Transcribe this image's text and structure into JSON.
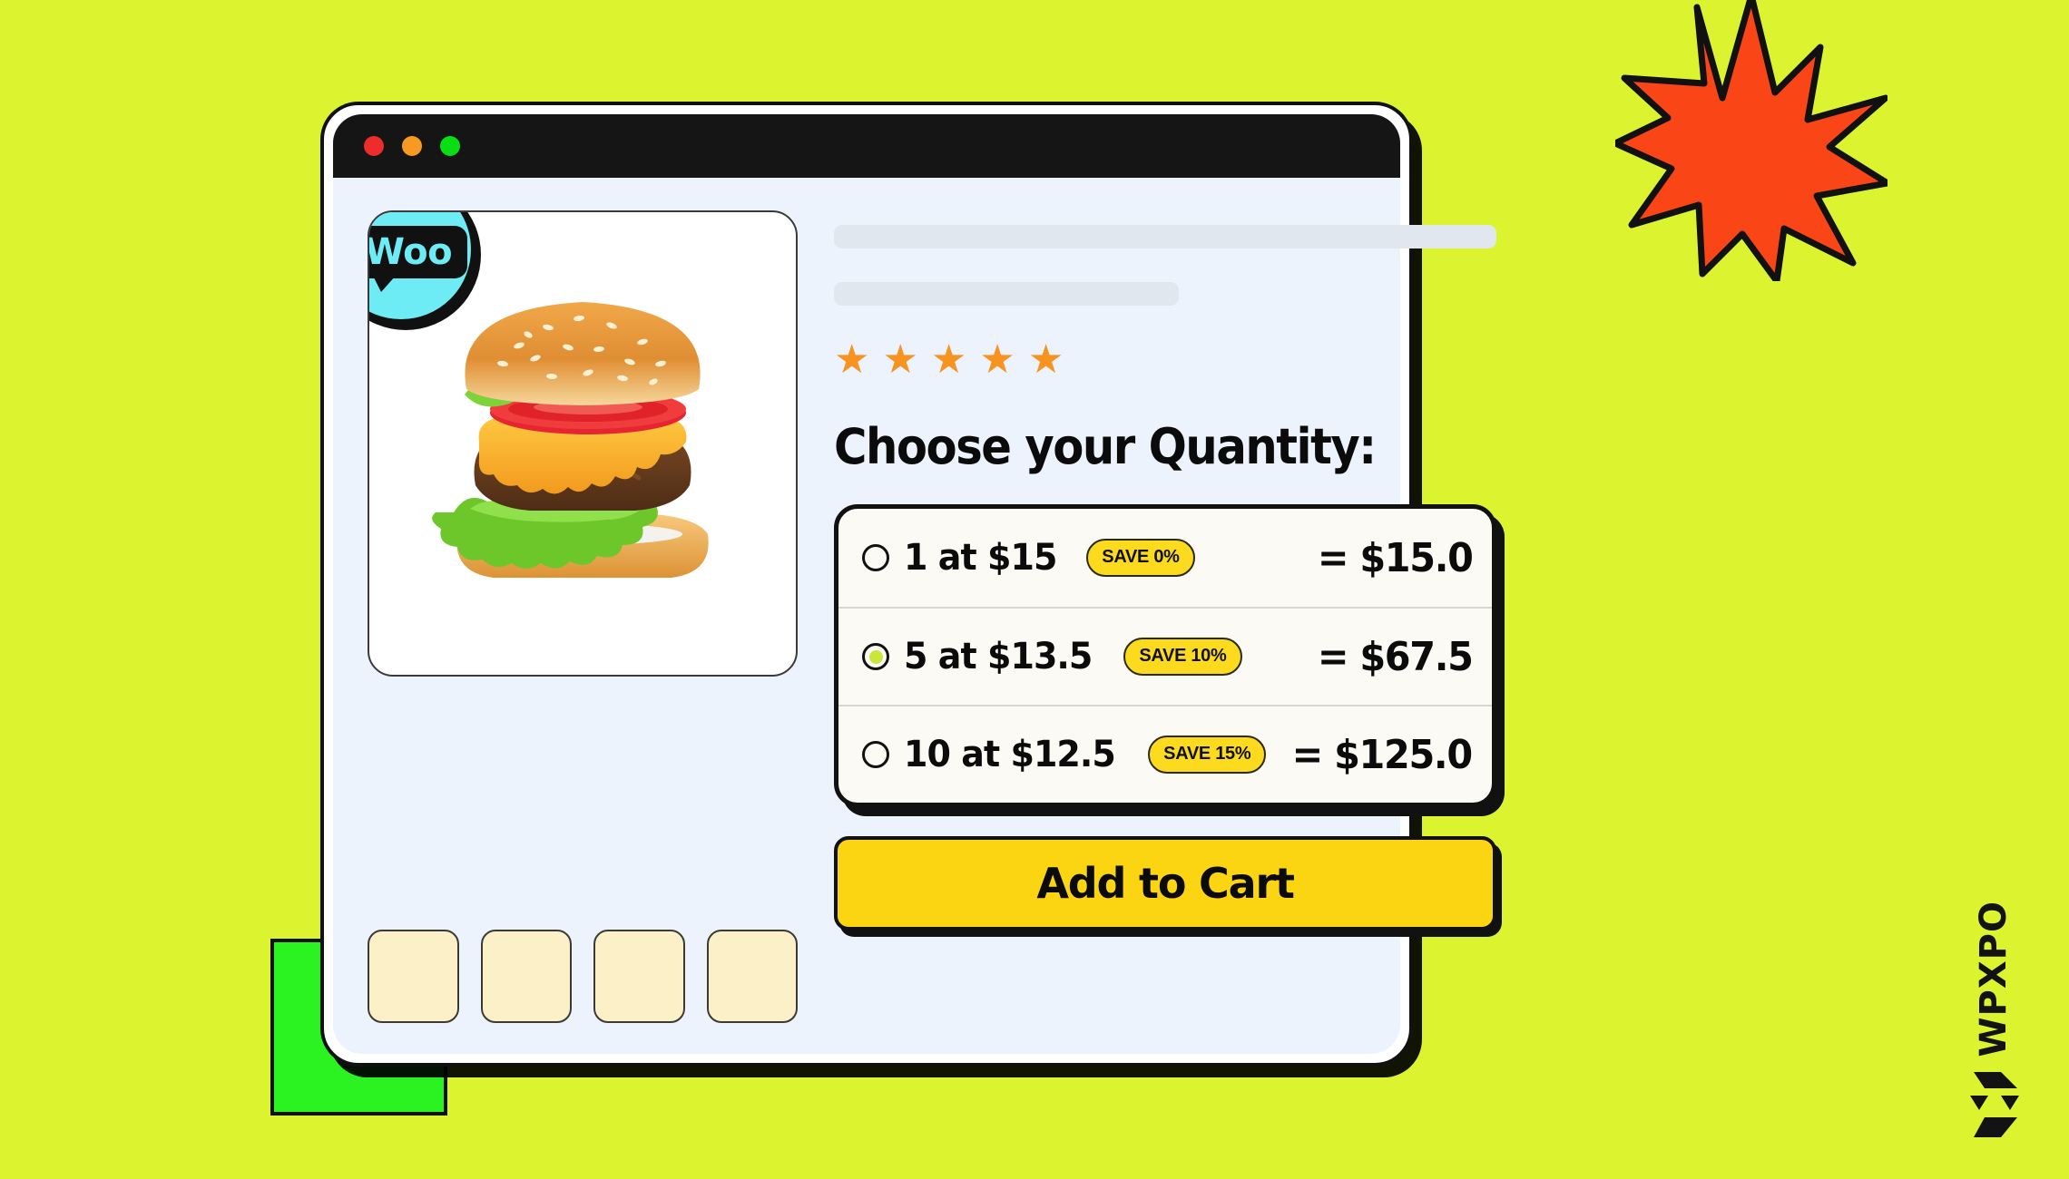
{
  "background_color": "#DCF430",
  "decor": {
    "starburst_fill": "#FA4616",
    "starburst_stroke": "#111111",
    "green_square_fill": "#2BF321"
  },
  "browser": {
    "frame_color": "#FFFFFF",
    "titlebar_color": "#151515",
    "body_color": "#EDF3FC",
    "traffic_lights": [
      {
        "name": "close",
        "color": "#ED2D2B"
      },
      {
        "name": "minimize",
        "color": "#F89A22"
      },
      {
        "name": "maximize",
        "color": "#08DE11"
      }
    ]
  },
  "badge": {
    "text": "Woo",
    "circle_color": "#6EECF5",
    "bubble_color": "#111111"
  },
  "gallery": {
    "main_image_alt": "cheeseburger with lettuce tomato onion and melted cheese",
    "thumbnails": [
      {
        "label": "thumbnail-1"
      },
      {
        "label": "thumbnail-2"
      },
      {
        "label": "thumbnail-3"
      },
      {
        "label": "thumbnail-4"
      }
    ],
    "thumbnail_color": "#FCF0C9"
  },
  "product": {
    "title_placeholder": "",
    "subtitle_placeholder": "",
    "rating": {
      "stars_filled": 5,
      "stars_total": 5,
      "star_glyph": "★",
      "star_color": "#F79321"
    }
  },
  "quantity": {
    "heading": "Choose your Quantity:",
    "selected_index": 1,
    "options": [
      {
        "quantity": 1,
        "unit_price": "$15",
        "label": "1 at $15",
        "save_label": "SAVE 0%",
        "save_percent": 0,
        "total_label": "= $15.0",
        "total": 15.0,
        "selected": false
      },
      {
        "quantity": 5,
        "unit_price": "$13.5",
        "label": "5 at $13.5",
        "save_label": "SAVE 10%",
        "save_percent": 10,
        "total_label": "= $67.5",
        "total": 67.5,
        "selected": true
      },
      {
        "quantity": 10,
        "unit_price": "$12.5",
        "label": "10 at $12.5",
        "save_label": "SAVE 15%",
        "save_percent": 15,
        "total_label": "= $125.0",
        "total": 125.0,
        "selected": false
      }
    ],
    "card_background": "#FBFAF4",
    "badge_color": "#FCDB1F",
    "radio_dot_color": "#C9E63B"
  },
  "cta": {
    "add_to_cart_label": "Add to Cart",
    "color": "#FCD512"
  },
  "watermark": {
    "wordmark": "WPXPO",
    "color": "#131313"
  }
}
